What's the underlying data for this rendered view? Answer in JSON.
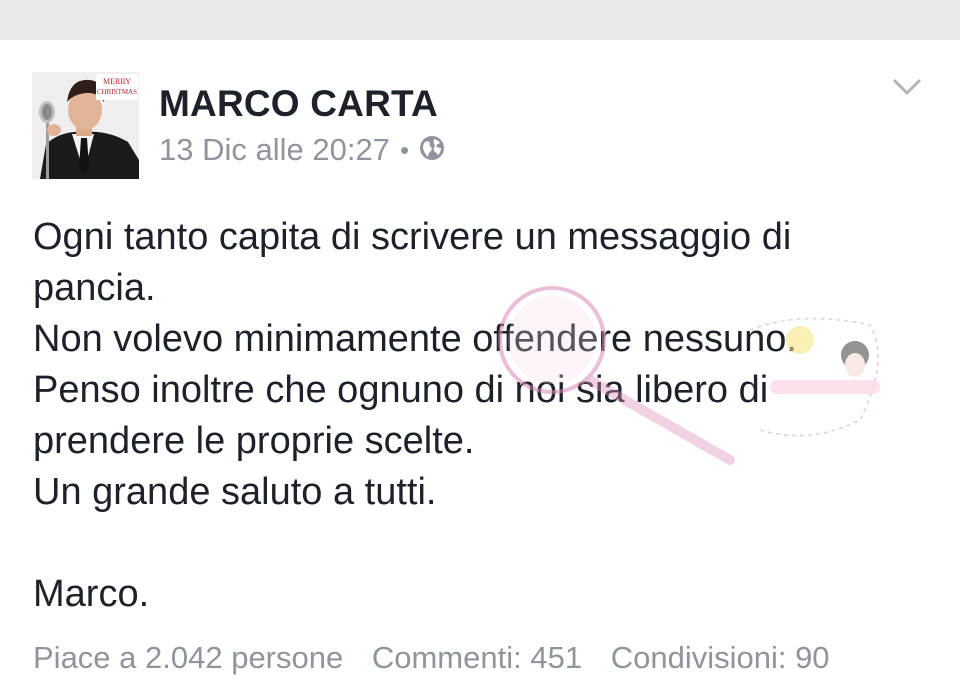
{
  "post": {
    "author": "MARCO CARTA",
    "timestamp": "13 Dic alle 20:27",
    "separator": "•",
    "privacy_icon": "globe-icon",
    "menu_icon": "chevron-down-icon",
    "avatar_text_line1": "MERRY",
    "avatar_text_line2": "CHRISTMAS",
    "paragraphs": [
      "Ogni tanto capita di scrivere un messaggio di",
      "pancia.",
      "Non volevo minimamente offendere nessuno.",
      "Penso inoltre che ognuno di noi sia libero di",
      "prendere le proprie scelte.",
      "Un grande saluto a tutti.",
      "",
      "Marco."
    ]
  },
  "stats": {
    "likes": "Piace a 2.042 persone",
    "comments": "Commenti: 451",
    "shares": "Condivisioni: 90"
  },
  "colors": {
    "background_strip": "#e9eaed",
    "text": "#1d2129",
    "meta": "#90949c"
  }
}
